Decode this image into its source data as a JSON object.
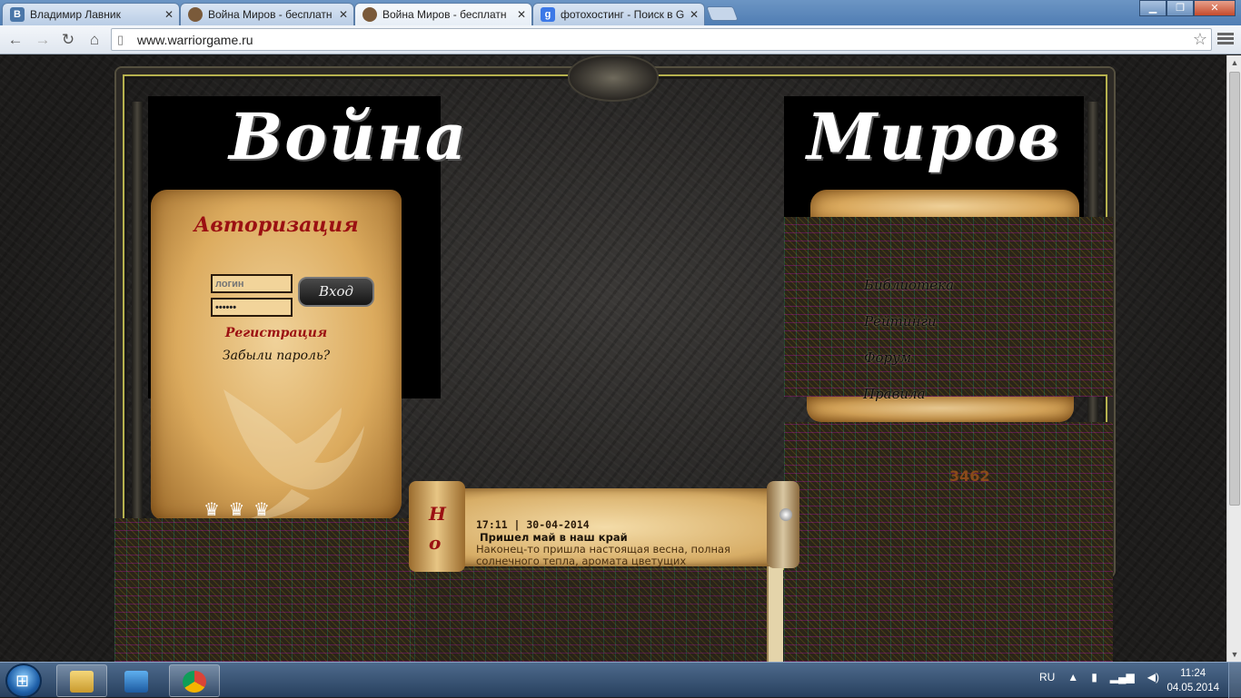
{
  "browser": {
    "tabs": [
      {
        "title": "Владимир Лавник",
        "icon": "vk-icon",
        "favicon_text": "B",
        "favicon_color": "#4a76a8"
      },
      {
        "title": "Война Миров - бесплатн",
        "icon": "game-icon",
        "favicon_text": "",
        "favicon_color": "#7a5a3a"
      },
      {
        "title": "Война Миров - бесплатн",
        "icon": "game-icon",
        "favicon_text": "",
        "favicon_color": "#7a5a3a"
      },
      {
        "title": "фотохостинг - Поиск в G",
        "icon": "google-icon",
        "favicon_text": "g",
        "favicon_color": "#3b78e7"
      }
    ],
    "url": "www.warriorgame.ru"
  },
  "site": {
    "title_left": "Война",
    "title_right": "Миров",
    "auth": {
      "title": "Авторизация",
      "login_placeholder": "логин",
      "password_value": "••••••",
      "login_button": "Вход",
      "register_link": "Регистрация",
      "forgot_link": "Забыли пароль?"
    },
    "menu": {
      "items": [
        "Библиотека",
        "Рейтинги",
        "Форум",
        "Правила"
      ]
    },
    "counter": "3462",
    "news": {
      "side_letters": [
        "Н",
        "о"
      ],
      "date": "17:11 | 30-04-2014",
      "headline": "Пришел май в наш край",
      "body": "Наконец-то пришла настоящая весна, полная солнечного тепла, аромата цветущих деревьев"
    }
  },
  "taskbar": {
    "tray_lang": "RU",
    "time": "11:24",
    "date": "04.05.2014"
  },
  "colors": {
    "accent_red": "#9b1012",
    "parchment": "#dcab5e",
    "frame_gold": "#b6b24e"
  }
}
